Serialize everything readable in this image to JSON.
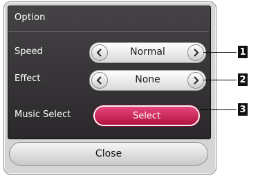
{
  "dialog": {
    "title": "Option",
    "rows": [
      {
        "label": "Speed",
        "value": "Normal"
      },
      {
        "label": "Effect",
        "value": "None"
      },
      {
        "label": "Music Select",
        "button": "Select"
      }
    ],
    "close_label": "Close"
  },
  "callouts": [
    "1",
    "2",
    "3"
  ],
  "colors": {
    "panel": "#353335",
    "select_button": "#c8245a",
    "frame": "#d5d5d5"
  }
}
